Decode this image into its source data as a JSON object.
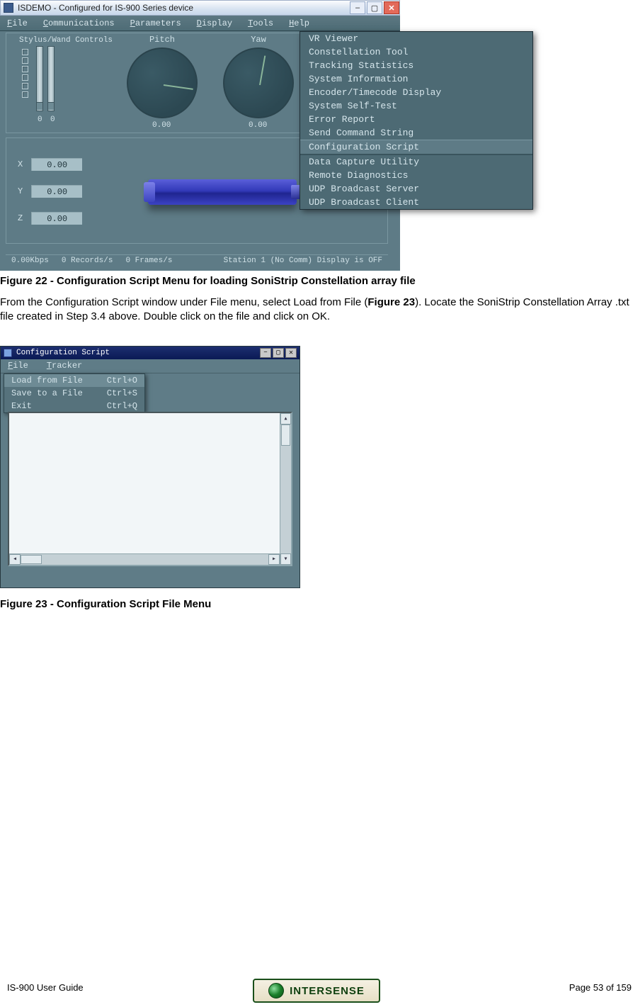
{
  "app1": {
    "title": "ISDEMO - Configured for IS-900 Series device",
    "menu": [
      "File",
      "Communications",
      "Parameters",
      "Display",
      "Tools",
      "Help"
    ],
    "tools_menu": [
      "VR Viewer",
      "Constellation Tool",
      "Tracking Statistics",
      "System Information",
      "Encoder/Timecode Display",
      "System Self-Test",
      "Error Report",
      "Send Command String",
      "Configuration Script",
      "Data Capture Utility",
      "Remote Diagnostics",
      "UDP Broadcast Server",
      "UDP Broadcast Client"
    ],
    "tools_menu_highlight_index": 8,
    "stylus_label": "Stylus/Wand Controls",
    "slider_vals": [
      "0",
      "0"
    ],
    "dials": {
      "pitch_label": "Pitch",
      "pitch_val": "0.00",
      "yaw_label": "Yaw",
      "yaw_val": "0.00"
    },
    "xyz": {
      "x_label": "X",
      "x_val": "0.00",
      "y_label": "Y",
      "y_val": "0.00",
      "z_label": "Z",
      "z_val": "0.00"
    },
    "status": {
      "kbps": "0.00Kbps",
      "records": "0 Records/s",
      "frames": "0 Frames/s",
      "station": "Station 1 (No Comm) Display is OFF"
    }
  },
  "caption22": "Figure 22 - Configuration Script Menu for loading SoniStrip Constellation array file",
  "para1_a": "From the Configuration Script window under File menu, select Load from File (",
  "para1_bold": "Figure 23",
  "para1_b": "). Locate the SoniStrip Constellation Array .txt file created in Step 3.4 above.  Double click on the file and click on OK.",
  "app2": {
    "title": "Configuration Script",
    "menu": [
      "File",
      "Tracker"
    ],
    "file_menu": [
      {
        "label": "Load from File",
        "shortcut": "Ctrl+O"
      },
      {
        "label": "Save to a File",
        "shortcut": "Ctrl+S"
      },
      {
        "label": "Exit",
        "shortcut": "Ctrl+Q"
      }
    ],
    "file_menu_highlight_index": 0
  },
  "caption23": "Figure 23 - Configuration Script File Menu",
  "footer_left": "IS-900 User Guide",
  "footer_right": "Page 53 of 159",
  "logo_text": "INTERSENSE"
}
